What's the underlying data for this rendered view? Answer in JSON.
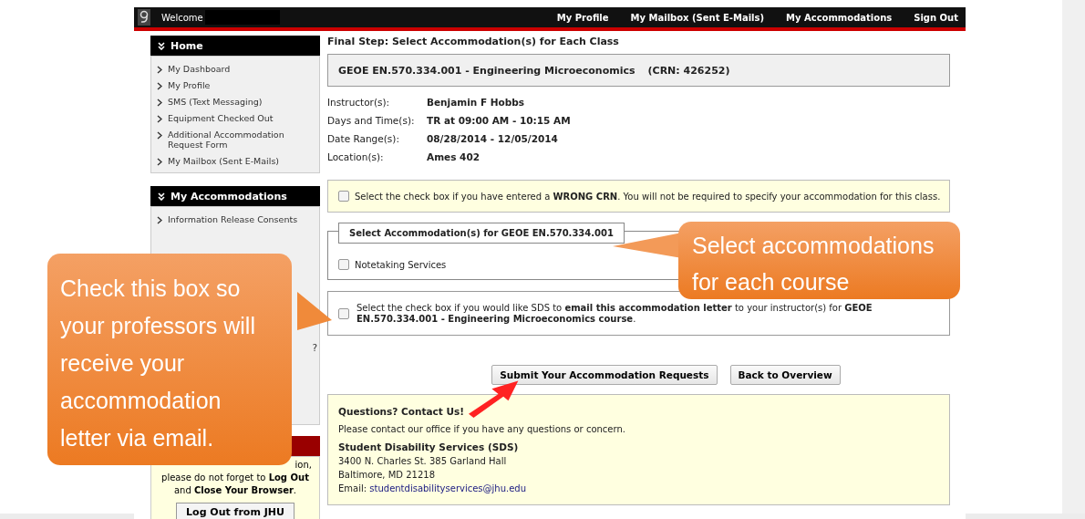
{
  "top_bar": {
    "welcome": "Welcome",
    "links": [
      "My Profile",
      "My Mailbox (Sent E-Mails)",
      "My Accommodations",
      "Sign Out"
    ]
  },
  "sidebar": {
    "sections": [
      {
        "title": "Home",
        "items": [
          "My Dashboard",
          "My Profile",
          "SMS (Text Messaging)",
          "Equipment Checked Out",
          "Additional Accommodation Request Form",
          "My Mailbox (Sent E-Mails)"
        ]
      },
      {
        "title": "My Accommodations",
        "items": [
          "Information Release Consents"
        ],
        "fragment": "?"
      }
    ],
    "logout": {
      "lines": [
        "ion,",
        "please do not forget to **Log Out**",
        "and **Close Your Browser**."
      ],
      "button": "Log Out from JHU"
    }
  },
  "content": {
    "heading": "Final Step: Select Accommodation(s) for Each Class",
    "course": {
      "title": "GEOE EN.570.334.001 - Engineering Microeconomics",
      "crn": "(CRN: 426252)"
    },
    "details": [
      {
        "label": "Instructor(s):",
        "value": "Benjamin F Hobbs"
      },
      {
        "label": "Days and Time(s):",
        "value": "TR at 09:00 AM - 10:15 AM"
      },
      {
        "label": "Date Range(s):",
        "value": "08/28/2014 - 12/05/2014"
      },
      {
        "label": "Location(s):",
        "value": "Ames 402"
      }
    ],
    "wrong_crn": {
      "text": "Select the check box if you have entered a **WRONG CRN**. You will not be required to specify your accommodation for this class.",
      "checked": false
    },
    "accommodations": {
      "legend": "Select Accommodation(s) for GEOE EN.570.334.001",
      "options": [
        {
          "label": "Notetaking Services",
          "checked": false
        }
      ]
    },
    "email_letter": {
      "text": "Select the check box if you would like SDS to **email this accommodation letter** to your instructor(s) for **GEOE EN.570.334.001 - Engineering Microeconomics course**.",
      "checked": false
    },
    "buttons": [
      "Submit Your Accommodation Requests",
      "Back to Overview"
    ],
    "contact": {
      "title": "Questions? Contact Us!",
      "intro": "Please contact our office if you have any questions or concern.",
      "org": "Student Disability Services (SDS)",
      "lines": [
        "3400 N. Charles St. 385 Garland Hall",
        "Baltimore, MD 21218"
      ],
      "email_label": "Email:",
      "email": "studentdisabilityservices@jhu.edu"
    }
  },
  "callouts": [
    {
      "text": "Check this box so your professors will receive your accommodation letter via email."
    },
    {
      "text": "Select accommodations for each course"
    }
  ]
}
